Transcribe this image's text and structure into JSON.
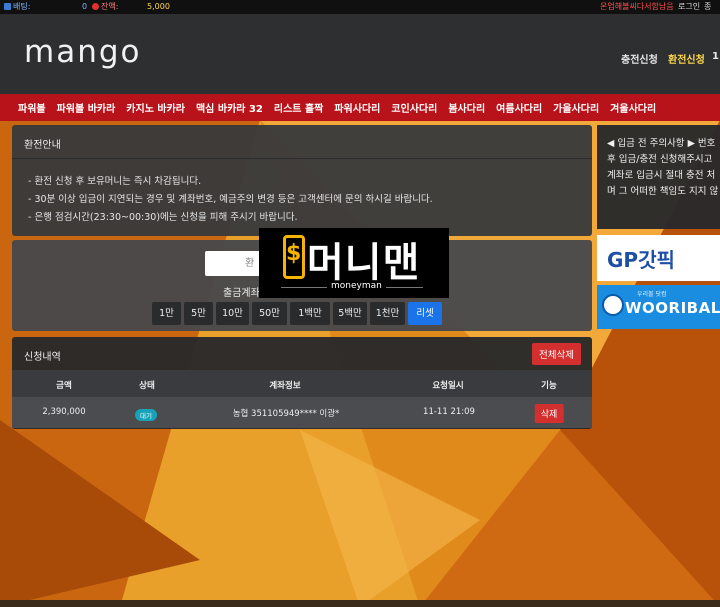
{
  "topbar": {
    "holding_label": "배팅:",
    "holding_value": "0",
    "balance_label": "잔액:",
    "balance_value": "5,000",
    "notice": "온업해볼씨다서함남음",
    "login": "로그인",
    "logout": "종"
  },
  "header": {
    "logo": "mango",
    "links": [
      "충전신청",
      "환전신청",
      "1:"
    ]
  },
  "nav": {
    "items": [
      "파워볼",
      "파워볼 바카라",
      "카지노 바카라",
      "맥심 바카라 32",
      "리스트 홀짝",
      "파워사다리",
      "코인사다리",
      "봄사다리",
      "여름사다리",
      "가을사다리",
      "겨울사다리"
    ]
  },
  "info": {
    "title": "환전안내",
    "lines": [
      "- 환전 신청 후 보유머니는 즉시 차감됩니다.",
      "- 30분 이상 입금이 지연되는 경우 및 계좌번호, 예금주의 변경 등은 고객센터에 문의 하시길 바랍니다.",
      "- 은행 점검시간(23:30~00:30)에는 신청을 피해 주시기 바랍니다."
    ]
  },
  "form": {
    "amount_placeholder": "환",
    "account_label": "출금계좌",
    "amount_buttons": [
      "1만",
      "5만",
      "10만",
      "50만",
      "1백만",
      "5백만",
      "1천만"
    ],
    "reset_label": "리셋"
  },
  "list": {
    "title": "신청내역",
    "delete_all": "전체삭제",
    "headers": [
      "금액",
      "상태",
      "계좌정보",
      "요청일시",
      "기능"
    ],
    "rows": [
      {
        "amount": "2,390,000",
        "status": "대기",
        "account": "농협 351105949**** 이광*",
        "date": "11-11 21:09",
        "action": "삭제"
      }
    ]
  },
  "side": {
    "notice_lines": [
      "◀ 입금 전 주의사항 ▶ 번호",
      "후 입금/충전 신청해주시고",
      "계좌로 입금시 절대 충전 처",
      "며 그 어떠한 책임도 지지 않"
    ],
    "banner1": "GP갓픽",
    "banner2_sub": "우리볼 닷컴",
    "banner2": "WOORIBALL"
  },
  "watermark": {
    "title": "머니맨",
    "sub": "moneyman"
  },
  "colors": {
    "nav_red": "#b8121a",
    "reset_blue": "#1a73e8",
    "delete_red": "#d32f2f",
    "badge_teal": "#17a2b8",
    "accent_yellow": "#ffd84a"
  }
}
